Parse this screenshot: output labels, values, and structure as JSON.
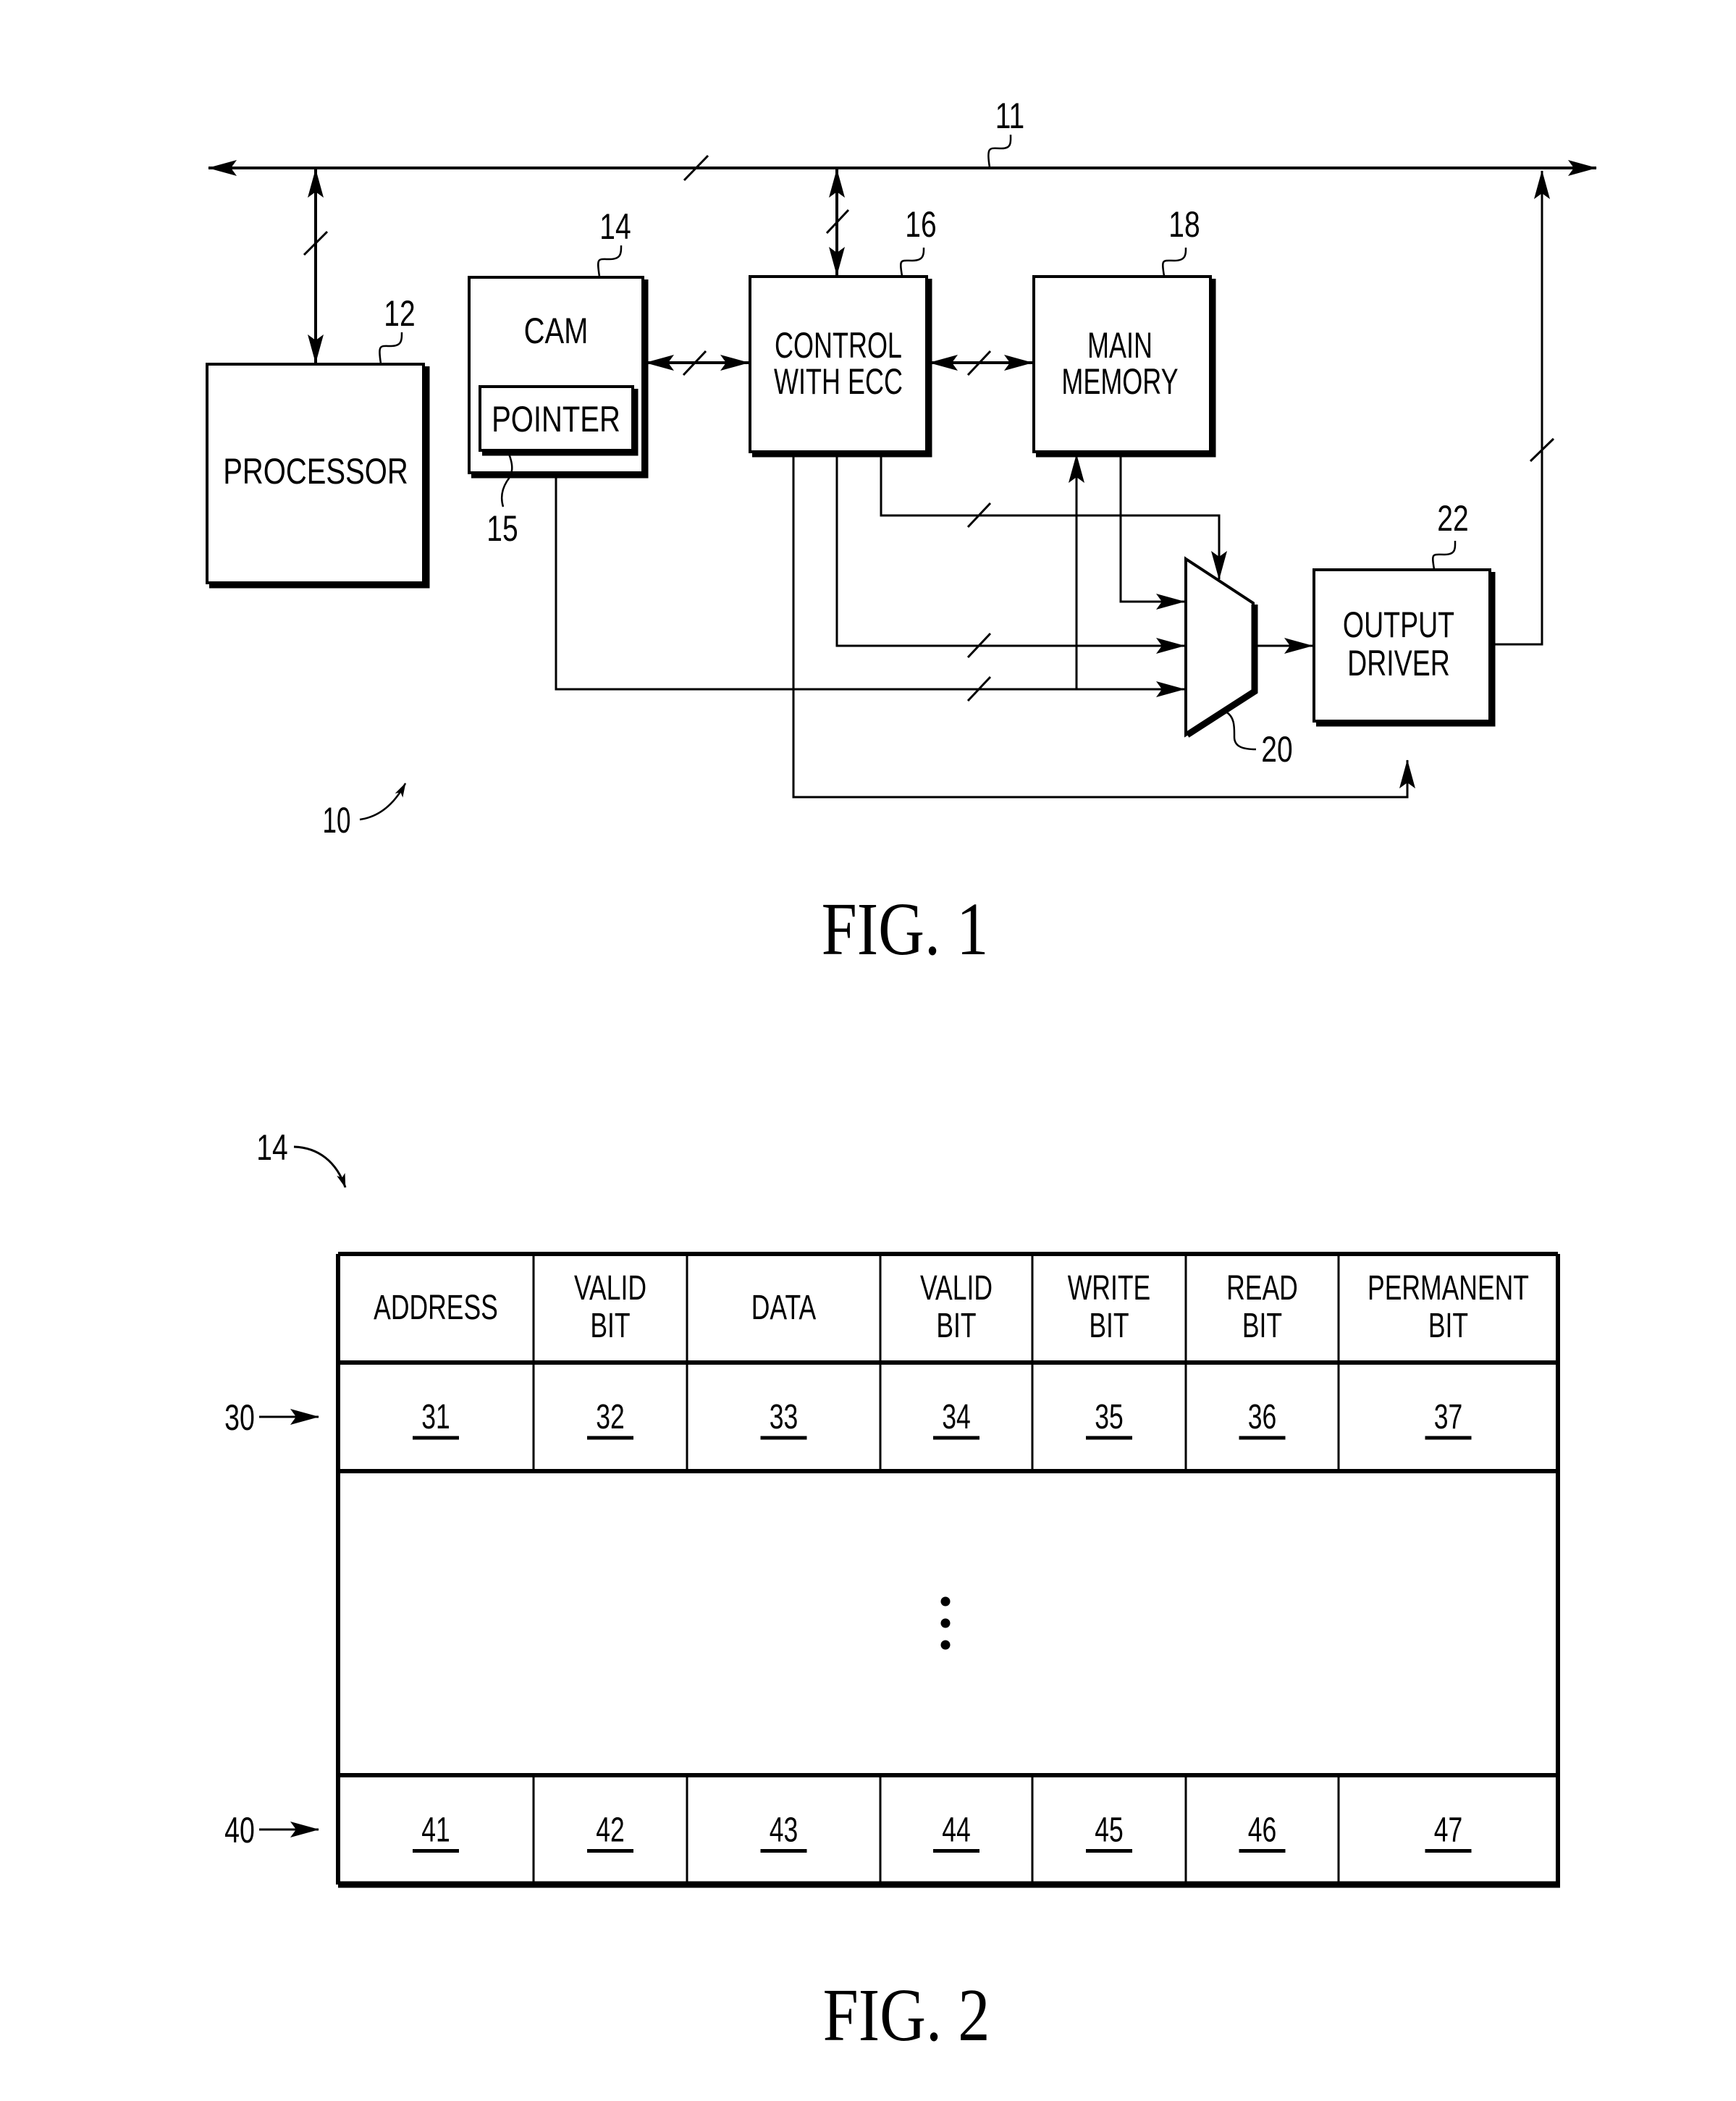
{
  "figure1": {
    "caption": "FIG. 1",
    "system_ref": "10",
    "bus": {
      "ref": "11"
    },
    "blocks": {
      "processor": {
        "ref": "12",
        "label": "PROCESSOR"
      },
      "cam": {
        "ref": "14",
        "label": "CAM"
      },
      "pointer": {
        "ref": "15",
        "label": "POINTER"
      },
      "control": {
        "ref": "16",
        "label_line1": "CONTROL",
        "label_line2": "WITH ECC"
      },
      "main_memory": {
        "ref": "18",
        "label_line1": "MAIN",
        "label_line2": "MEMORY"
      },
      "mux": {
        "ref": "20"
      },
      "output_driver": {
        "ref": "22",
        "label_line1": "OUTPUT",
        "label_line2": "DRIVER"
      }
    }
  },
  "figure2": {
    "caption": "FIG. 2",
    "table_ref": "14",
    "headers": [
      {
        "line1": "ADDRESS",
        "line2": ""
      },
      {
        "line1": "VALID",
        "line2": "BIT"
      },
      {
        "line1": "DATA",
        "line2": ""
      },
      {
        "line1": "VALID",
        "line2": "BIT"
      },
      {
        "line1": "WRITE",
        "line2": "BIT"
      },
      {
        "line1": "READ",
        "line2": "BIT"
      },
      {
        "line1": "PERMANENT",
        "line2": "BIT"
      }
    ],
    "rows": [
      {
        "ref": "30",
        "cells": [
          "31",
          "32",
          "33",
          "34",
          "35",
          "36",
          "37"
        ]
      },
      {
        "ref": "40",
        "cells": [
          "41",
          "42",
          "43",
          "44",
          "45",
          "46",
          "47"
        ]
      }
    ],
    "ellipsis": "⋮"
  }
}
